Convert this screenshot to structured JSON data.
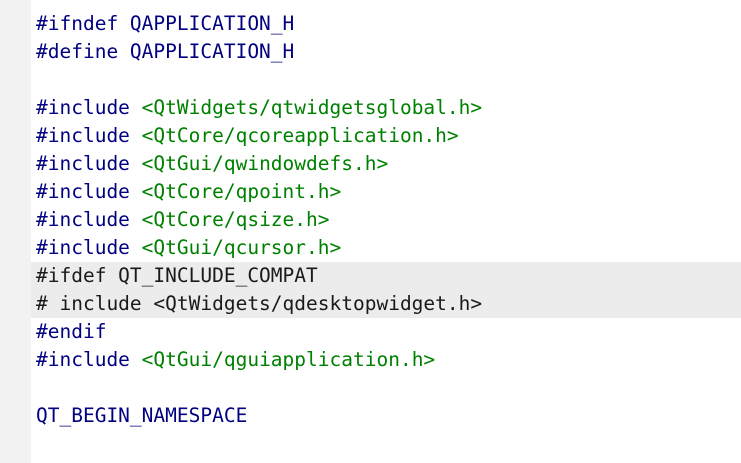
{
  "editor": {
    "colors": {
      "directive": "#000080",
      "include_path": "#008000",
      "inactive_text": "#1a1a1a",
      "inactive_block_background": "#ececec",
      "gutter": "#f2f2f2",
      "background": "#ffffff"
    },
    "lines": [
      {
        "directive": "#ifndef QAPPLICATION_H",
        "arg": ""
      },
      {
        "directive": "#define QAPPLICATION_H",
        "arg": ""
      },
      {
        "directive": "",
        "arg": ""
      },
      {
        "directive": "#include ",
        "arg": "<QtWidgets/qtwidgetsglobal.h>"
      },
      {
        "directive": "#include ",
        "arg": "<QtCore/qcoreapplication.h>"
      },
      {
        "directive": "#include ",
        "arg": "<QtGui/qwindowdefs.h>"
      },
      {
        "directive": "#include ",
        "arg": "<QtCore/qpoint.h>"
      },
      {
        "directive": "#include ",
        "arg": "<QtCore/qsize.h>"
      },
      {
        "directive": "#include ",
        "arg": "<QtGui/qcursor.h>"
      },
      {
        "directive": "#ifdef QT_INCLUDE_COMPAT",
        "arg": ""
      },
      {
        "directive": "# include <QtWidgets/qdesktopwidget.h>",
        "arg": ""
      },
      {
        "directive": "#endif",
        "arg": ""
      },
      {
        "directive": "#include ",
        "arg": "<QtGui/qguiapplication.h>"
      },
      {
        "directive": "",
        "arg": ""
      },
      {
        "directive": "QT_BEGIN_NAMESPACE",
        "arg": ""
      }
    ]
  }
}
